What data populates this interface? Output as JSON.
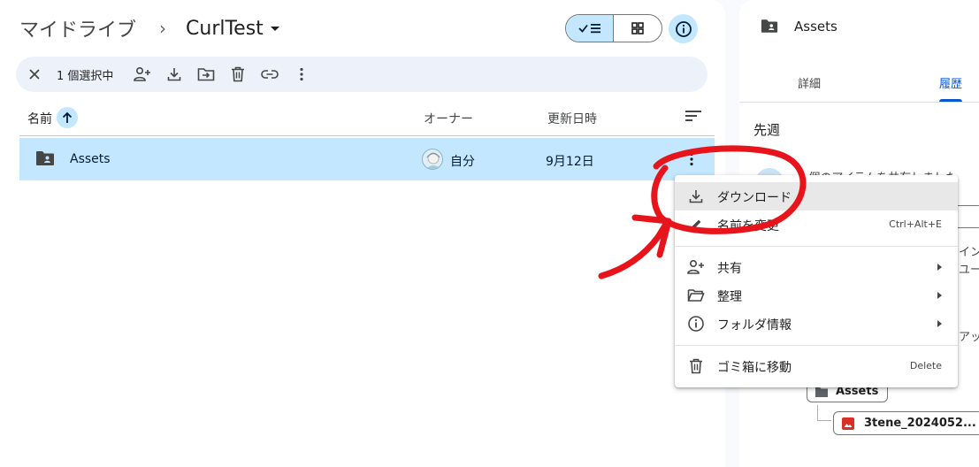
{
  "breadcrumb": {
    "root": "マイドライブ",
    "separator": "›",
    "current": "CurlTest"
  },
  "toolbar": {
    "selection_count": "1 個選択中"
  },
  "list": {
    "headers": {
      "name": "名前",
      "owner": "オーナー",
      "modified": "更新日時"
    },
    "rows": [
      {
        "name": "Assets",
        "owner": "自分",
        "modified": "9月12日"
      }
    ]
  },
  "context_menu": {
    "items": [
      {
        "label": "ダウンロード",
        "icon": "download-icon"
      },
      {
        "label": "名前を変更",
        "shortcut": "Ctrl+Alt+E",
        "icon": "pencil-icon"
      },
      {
        "label": "共有",
        "icon": "person-add-icon"
      },
      {
        "label": "整理",
        "icon": "folder-open-icon"
      },
      {
        "label": "フォルダ情報",
        "icon": "info-icon"
      },
      {
        "label": "ゴミ箱に移動",
        "shortcut": "Delete",
        "icon": "trash-icon"
      }
    ]
  },
  "details_panel": {
    "title": "Assets",
    "tabs": [
      "詳細",
      "履歴"
    ],
    "section": "先週",
    "activity_text": "1 個のアイテムを共有しました",
    "fragment_1": "イン",
    "fragment_2": "ユー",
    "fragment_3": "アッ",
    "folder_chip": "Assets",
    "file_chip": "3tene_2024052..."
  },
  "colors": {
    "selected": "#c2e7ff",
    "accent": "#0b57d0",
    "toolbar_bg": "#edf2fa",
    "annotation": "#e8141c"
  }
}
